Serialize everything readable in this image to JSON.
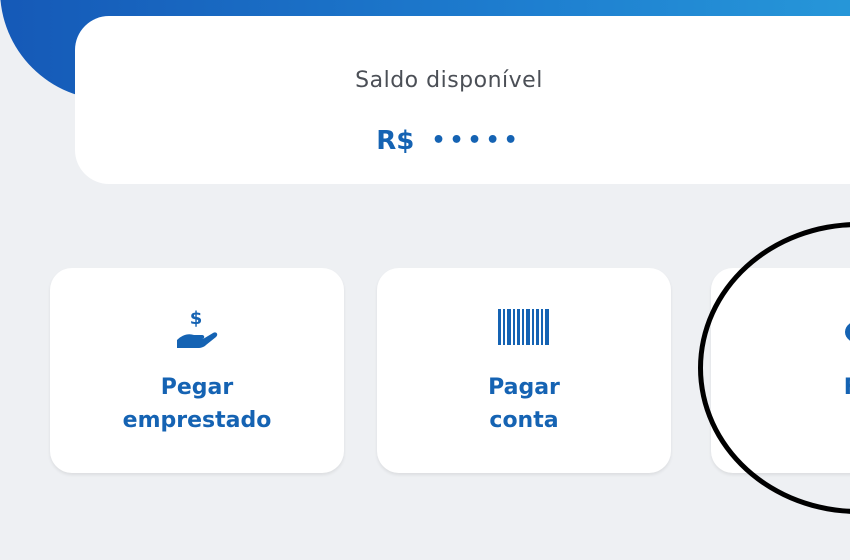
{
  "balance": {
    "label": "Saldo disponível",
    "currency": "R$",
    "masked_value": "•••••"
  },
  "actions": [
    {
      "line1": "Pegar",
      "line2": "emprestado",
      "icon": "hand-dollar-icon"
    },
    {
      "line1": "Pagar",
      "line2": "conta",
      "icon": "barcode-icon"
    },
    {
      "line1": "Fa",
      "line2": "P",
      "icon": "piggy-bank-icon"
    }
  ],
  "colors": {
    "brand_blue": "#1563b3",
    "header_gradient_start": "#1559b7",
    "header_gradient_end": "#2aa0dc",
    "background": "#eef0f3"
  }
}
